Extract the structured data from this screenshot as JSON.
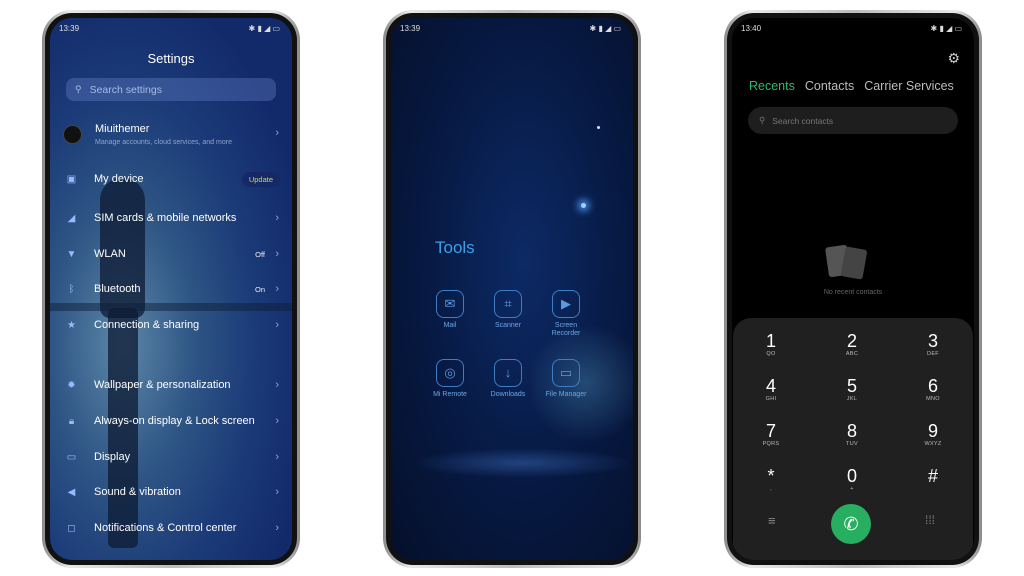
{
  "settings_phone": {
    "status_time": "13:39",
    "title": "Settings",
    "search_placeholder": "Search settings",
    "account": {
      "name": "Miuithemer",
      "subtitle": "Manage accounts, cloud services, and more"
    },
    "my_device": {
      "label": "My device",
      "badge": "Update"
    },
    "items": [
      {
        "label": "SIM cards & mobile networks",
        "icon": "signal-icon",
        "value": ""
      },
      {
        "label": "WLAN",
        "icon": "wifi-icon",
        "value": "Off"
      },
      {
        "label": "Bluetooth",
        "icon": "bluetooth-icon",
        "value": "On"
      },
      {
        "label": "Connection & sharing",
        "icon": "share-icon",
        "value": ""
      },
      {
        "label": "Wallpaper & personalization",
        "icon": "wallpaper-icon",
        "value": ""
      },
      {
        "label": "Always-on display & Lock screen",
        "icon": "lock-icon",
        "value": ""
      },
      {
        "label": "Display",
        "icon": "display-icon",
        "value": ""
      },
      {
        "label": "Sound & vibration",
        "icon": "speaker-icon",
        "value": ""
      },
      {
        "label": "Notifications & Control center",
        "icon": "notification-icon",
        "value": ""
      }
    ]
  },
  "tools_phone": {
    "status_time": "13:39",
    "folder_title": "Tools",
    "apps": [
      {
        "label": "Mail",
        "icon": "mail-icon"
      },
      {
        "label": "Scanner",
        "icon": "scanner-icon"
      },
      {
        "label": "Screen Recorder",
        "icon": "video-icon"
      },
      {
        "label": "Mi Remote",
        "icon": "remote-icon"
      },
      {
        "label": "Downloads",
        "icon": "download-icon"
      },
      {
        "label": "File Manager",
        "icon": "folder-icon"
      }
    ]
  },
  "dialer_phone": {
    "status_time": "13:40",
    "tabs": [
      "Recents",
      "Contacts",
      "Carrier Services"
    ],
    "active_tab": "Recents",
    "search_placeholder": "Search contacts",
    "empty_text": "No recent contacts",
    "keys": [
      {
        "digit": "1",
        "letters": "QO"
      },
      {
        "digit": "2",
        "letters": "ABC"
      },
      {
        "digit": "3",
        "letters": "DEF"
      },
      {
        "digit": "4",
        "letters": "GHI"
      },
      {
        "digit": "5",
        "letters": "JKL"
      },
      {
        "digit": "6",
        "letters": "MNO"
      },
      {
        "digit": "7",
        "letters": "PQRS"
      },
      {
        "digit": "8",
        "letters": "TUV"
      },
      {
        "digit": "9",
        "letters": "WXYZ"
      },
      {
        "digit": "*",
        "letters": ","
      },
      {
        "digit": "0",
        "letters": "+"
      },
      {
        "digit": "#",
        "letters": ""
      }
    ],
    "colors": {
      "accent": "#2fb86a",
      "call": "#27ae60",
      "keypad_bg": "#202020"
    }
  }
}
